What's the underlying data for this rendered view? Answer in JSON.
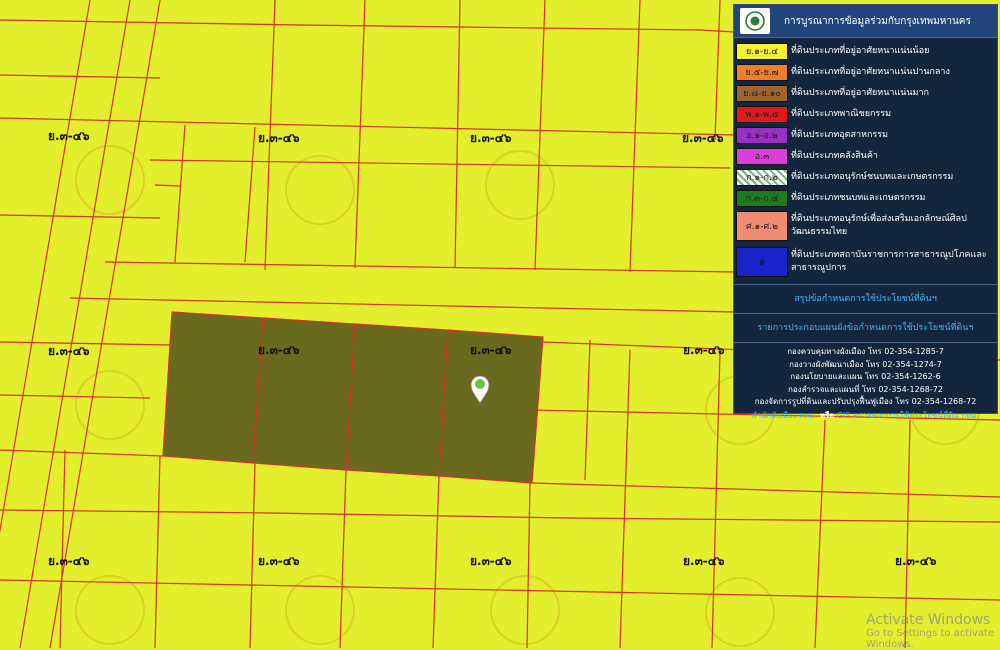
{
  "map": {
    "zone_labels": [
      "ย.๓-๔๖",
      "ย.๓-๔๖",
      "ย.๓-๔๖",
      "ย.๓-๔๖",
      "ย.๓-๔๖",
      "ย.๓-๔๖",
      "ย.๓-๔๖",
      "ย.๓-๔๖",
      "ย.๓-๔๖",
      "ย.๓-๔๖",
      "ย.๓-๔๖",
      "ย.๓-๔๖",
      "ย.๓-๔๖"
    ],
    "colors": {
      "base": "#e3ee2c",
      "lines": "#d6312b",
      "selection": "#6a6a1e"
    },
    "marker_icon": "location-pin-icon"
  },
  "legend": {
    "title": "การบูรณาการข้อมูลร่วมกับกรุงเทพมหานคร",
    "logo_icon": "bma-seal-icon",
    "items": [
      {
        "code": "ย.๑-ย.๔",
        "text": "ที่ดินประเภทที่อยู่อาศัยหนาแน่นน้อย",
        "color": "#f6f233"
      },
      {
        "code": "ย.๕-ย.๗",
        "text": "ที่ดินประเภทที่อยู่อาศัยหนาแน่นปานกลาง",
        "color": "#ef7e2e"
      },
      {
        "code": "ย.๘-ย.๑๐",
        "text": "ที่ดินประเภทที่อยู่อาศัยหนาแน่นมาก",
        "color": "#a0652c"
      },
      {
        "code": "พ.๑-พ.๕",
        "text": "ที่ดินประเภทพาณิชยกรรม",
        "color": "#e3171c"
      },
      {
        "code": "อ.๑-อ.๒",
        "text": "ที่ดินประเภทอุตสาหกรรม",
        "color": "#9a2fc4"
      },
      {
        "code": "อ.๓",
        "text": "ที่ดินประเภทคลังสินค้า",
        "color": "#dc3fd9"
      },
      {
        "code": "ก.๑-ก.๒",
        "text": "ที่ดินประเภทอนุรักษ์ชนบทและเกษตรกรรม",
        "color": "hatch"
      },
      {
        "code": "ก.๓-ก.๔",
        "text": "ที่ดินประเภทชนบทและเกษตรกรรม",
        "color": "#1d7b1f"
      },
      {
        "code": "ศ.๑-ศ.๒",
        "text": "ที่ดินประเภทอนุรักษ์เพื่อส่งเสริมเอกลักษณ์ศิลป วัฒนธรรมไทย",
        "color": "#f08c72"
      },
      {
        "code": "ส",
        "text": "ที่ดินประเภทสถาบันราชการการสาธารณูปโภคและสาธารณูปการ",
        "color": "#1a23c9"
      }
    ],
    "links": [
      "สรุปข้อกำหนดการใช้ประโยชน์ที่ดินฯ",
      "รายการประกอบแผนผังข้อกำหนดการใช้ประโยชน์ที่ดินฯ"
    ],
    "contacts": [
      "กองควบคุมทางผังเมือง โทร 02-354-1285-7",
      "กองวางผังพัฒนาเมือง โทร 02-354-1274-7",
      "กองนโยบายและแผน โทร 02-354-1262-6",
      "กองสำรวจและแผนที่ โทร 02-354-1268-72",
      "กองจัดการรูปที่ดินและปรับปรุงฟื้นฟูเมือง โทร 02-354-1268-72"
    ],
    "footer": {
      "left": "สำนักผังเมือง กทม.",
      "sep": "หรือ",
      "right": "GIS ตรวจสอบการใช้ประโยชน์ที่ดิน กทม."
    }
  },
  "watermark": {
    "line1": "Activate Windows",
    "line2": "Go to Settings to activate Windows."
  }
}
